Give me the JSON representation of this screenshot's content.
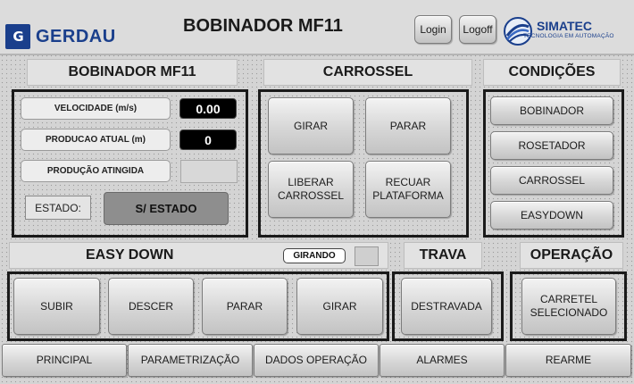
{
  "header": {
    "logo_mark": "G",
    "logo_text": "GERDAU",
    "title": "BOBINADOR MF11",
    "login_label": "Login",
    "logoff_label": "Logoff",
    "brand_name": "SIMATEC",
    "brand_sub": "TECNOLOGIA EM AUTOMAÇÃO"
  },
  "bobinador": {
    "title": "BOBINADOR MF11",
    "velocidade_label": "VELOCIDADE (m/s)",
    "velocidade_value": "0.00",
    "producao_label": "PRODUCAO ATUAL (m)",
    "producao_value": "0",
    "producao_atingida_label": "PRODUÇÃO ATINGIDA",
    "estado_label": "ESTADO:",
    "estado_value": "S/ ESTADO"
  },
  "carrossel": {
    "title": "CARROSSEL",
    "girar": "GIRAR",
    "parar": "PARAR",
    "liberar": "LIBERAR CARROSSEL",
    "recuar": "RECUAR PLATAFORMA"
  },
  "condicoes": {
    "title": "CONDIÇÕES",
    "items": [
      "BOBINADOR",
      "ROSETADOR",
      "CARROSSEL",
      "EASYDOWN"
    ]
  },
  "easydown": {
    "title": "EASY DOWN",
    "status": "GIRANDO",
    "buttons": [
      "SUBIR",
      "DESCER",
      "PARAR",
      "GIRAR"
    ]
  },
  "trava": {
    "title": "TRAVA",
    "button": "DESTRAVADA"
  },
  "operacao": {
    "title": "OPERAÇÃO",
    "button": "CARRETEL SELECIONADO"
  },
  "nav": {
    "items": [
      "PRINCIPAL",
      "PARAMETRIZAÇÃO",
      "DADOS OPERAÇÃO",
      "ALARMES",
      "REARME"
    ]
  },
  "colors": {
    "brand_blue": "#1a3f8c",
    "value_bg": "#000000",
    "estado_bg": "#8e8e8e"
  }
}
